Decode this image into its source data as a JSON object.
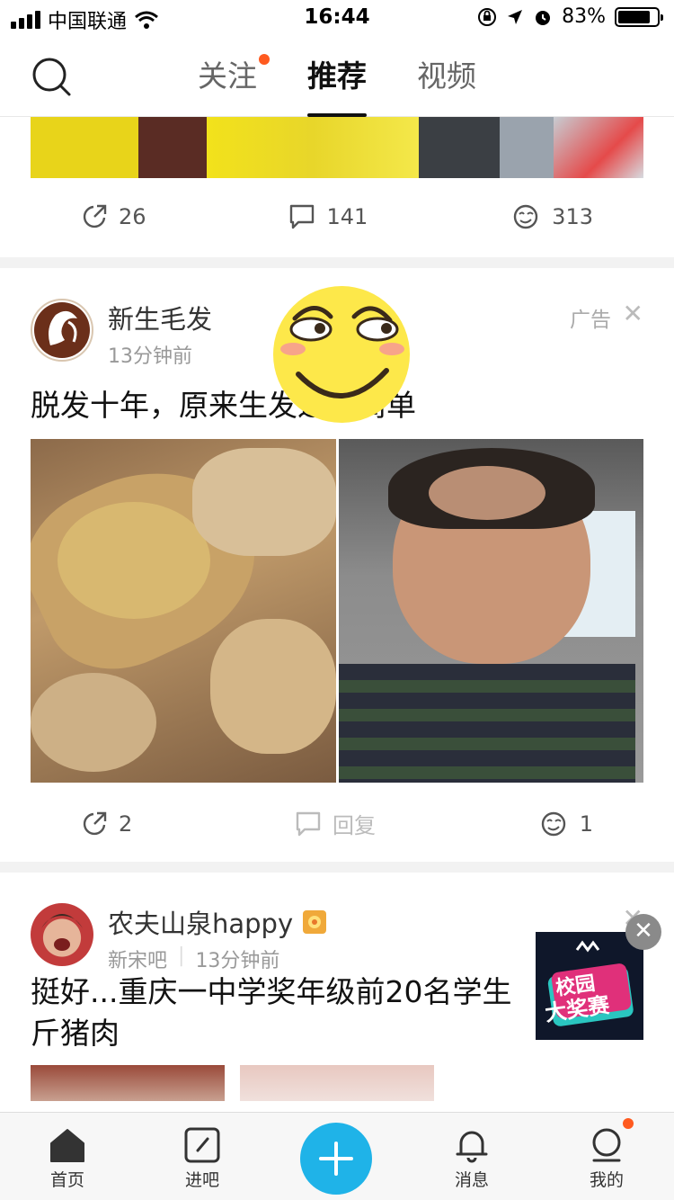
{
  "status_bar": {
    "carrier": "中国联通",
    "time": "16:44",
    "battery_pct": "83%"
  },
  "top_nav": {
    "tabs": [
      "关注",
      "推荐",
      "视频"
    ],
    "active_tab": "推荐"
  },
  "feed": {
    "post1": {
      "share_count": "26",
      "comment_count": "141",
      "like_count": "313"
    },
    "post2": {
      "author": "新生毛发",
      "time": "13分钟前",
      "ad_label": "广告",
      "title": "脱发十年，原来生发这么简单",
      "share_count": "2",
      "reply_label": "回复",
      "like_count": "1"
    },
    "post3": {
      "author": "农夫山泉happy",
      "forum": "新宋吧",
      "time": "13分钟前",
      "title_line1": "挺好...重庆一中学奖年级前20名学生",
      "title_line2": "斤猪肉"
    }
  },
  "promo": {
    "text1": "校园",
    "text2": "大奖赛"
  },
  "tab_bar": {
    "items": [
      "首页",
      "进吧",
      "消息",
      "我的"
    ]
  },
  "colors": {
    "accent": "#1fb3e8",
    "notify": "#ff5a1f"
  }
}
